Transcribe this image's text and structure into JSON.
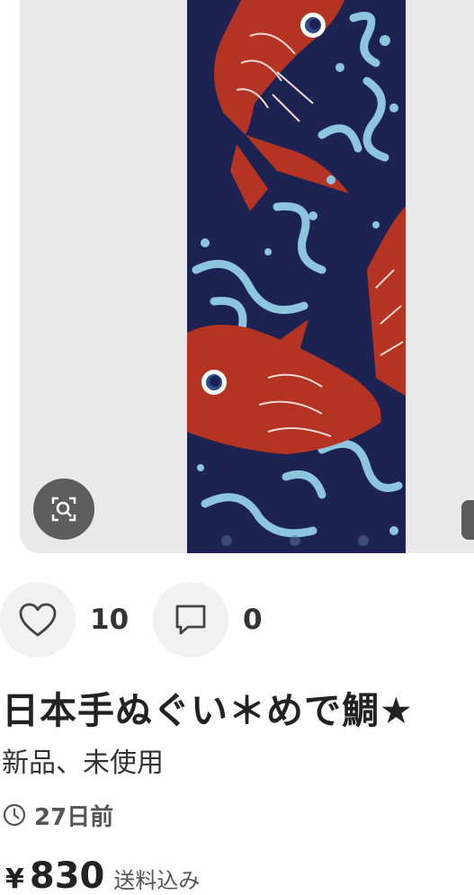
{
  "product": {
    "image_alt": "日本手ぬぐい めで鯛",
    "likes": {
      "count": "10",
      "icon": "heart-icon"
    },
    "comments": {
      "count": "0",
      "icon": "comment-icon"
    },
    "title": "日本手ぬぐい＊めで鯛★",
    "condition": "新品、未使用",
    "posted": {
      "icon": "clock-icon",
      "text": "27日前"
    },
    "price": {
      "symbol": "¥",
      "value": "830",
      "note": "送料込み"
    }
  },
  "carousel": {
    "slide_count": 3,
    "active_slide": 1
  },
  "colors": {
    "navy": "#1c2352",
    "red": "#b43322",
    "wave": "#8ec5de",
    "panel": "#e9e9e9"
  }
}
